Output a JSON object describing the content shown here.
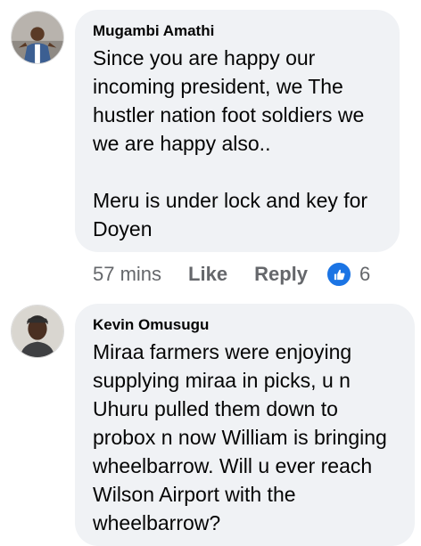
{
  "comments": [
    {
      "author": "Mugambi Amathi",
      "text": "Since you are happy our\nincoming president, we The\nhustler nation foot soldiers we\nwe are happy also..\n\nMeru is under lock and key for\nDoyen",
      "time": "57 mins",
      "like_label": "Like",
      "reply_label": "Reply",
      "reaction_icon": "like-icon",
      "reaction_count": "6"
    },
    {
      "author": "Kevin Omusugu",
      "text": "Miraa farmers were enjoying\nsupplying miraa in picks, u n\nUhuru pulled them down to\nprobox n now William is bringing\nwheelbarrow. Will u ever reach\nWilson Airport with the\nwheelbarrow?"
    }
  ],
  "colors": {
    "bubble": "#f0f2f5",
    "meta_text": "#65676b",
    "reaction_blue": "#1b74e4"
  }
}
